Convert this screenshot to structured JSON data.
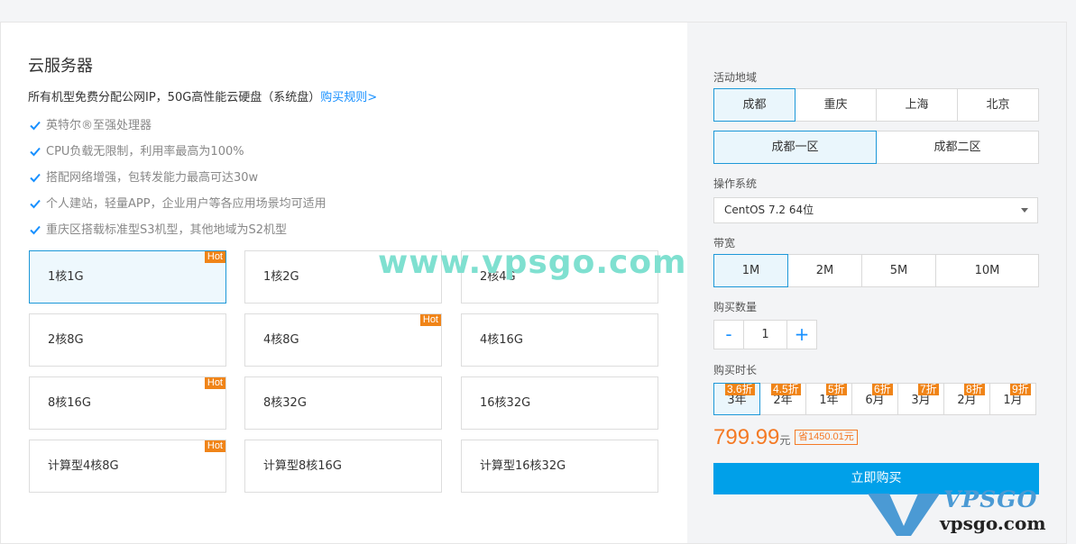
{
  "product": {
    "title": "云服务器",
    "description": "所有机型免费分配公网IP，50G高性能云硬盘（系统盘）",
    "rules_link": "购买规则>",
    "features": [
      "英特尔®至强处理器",
      "CPU负载无限制，利用率最高为100%",
      "搭配网络增强，包转发能力最高可达30w",
      "个人建站，轻量APP，企业用户等各应用场景均可适用",
      "重庆区搭载标准型S3机型，其他地域为S2机型"
    ],
    "hot_label": "Hot",
    "plans": [
      {
        "label": "1核1G",
        "selected": true,
        "hot": true
      },
      {
        "label": "1核2G",
        "selected": false,
        "hot": false
      },
      {
        "label": "2核4G",
        "selected": false,
        "hot": false
      },
      {
        "label": "2核8G",
        "selected": false,
        "hot": false
      },
      {
        "label": "4核8G",
        "selected": false,
        "hot": true
      },
      {
        "label": "4核16G",
        "selected": false,
        "hot": false
      },
      {
        "label": "8核16G",
        "selected": false,
        "hot": true
      },
      {
        "label": "8核32G",
        "selected": false,
        "hot": false
      },
      {
        "label": "16核32G",
        "selected": false,
        "hot": false
      },
      {
        "label": "计算型4核8G",
        "selected": false,
        "hot": true
      },
      {
        "label": "计算型8核16G",
        "selected": false,
        "hot": false
      },
      {
        "label": "计算型16核32G",
        "selected": false,
        "hot": false
      }
    ]
  },
  "watermark": "www.vpsgo.com",
  "config": {
    "region_label": "活动地域",
    "regions": [
      "成都",
      "重庆",
      "上海",
      "北京"
    ],
    "zones": [
      "成都一区",
      "成都二区"
    ],
    "os_label": "操作系统",
    "os_value": "CentOS 7.2 64位",
    "bandwidth_label": "带宽",
    "bandwidths": [
      "1M",
      "2M",
      "5M",
      "10M"
    ],
    "quantity_label": "购买数量",
    "quantity_minus": "-",
    "quantity_value": "1",
    "quantity_plus": "+",
    "duration_label": "购买时长",
    "durations": [
      {
        "label": "3年",
        "discount": "3.6折"
      },
      {
        "label": "2年",
        "discount": "4.5折"
      },
      {
        "label": "1年",
        "discount": "5折"
      },
      {
        "label": "6月",
        "discount": "6折"
      },
      {
        "label": "3月",
        "discount": "7折"
      },
      {
        "label": "2月",
        "discount": "8折"
      },
      {
        "label": "1月",
        "discount": "9折"
      }
    ],
    "price": "799.99",
    "price_unit": "元",
    "savings": "省1450.01元",
    "buy_button": "立即购买"
  },
  "logo": {
    "top": "VPSGO",
    "bottom": "vpsgo.com"
  },
  "colors": {
    "accent": "#1d98d8",
    "hot": "#f08418",
    "price": "#f47a25",
    "buy": "#00a0e9"
  }
}
